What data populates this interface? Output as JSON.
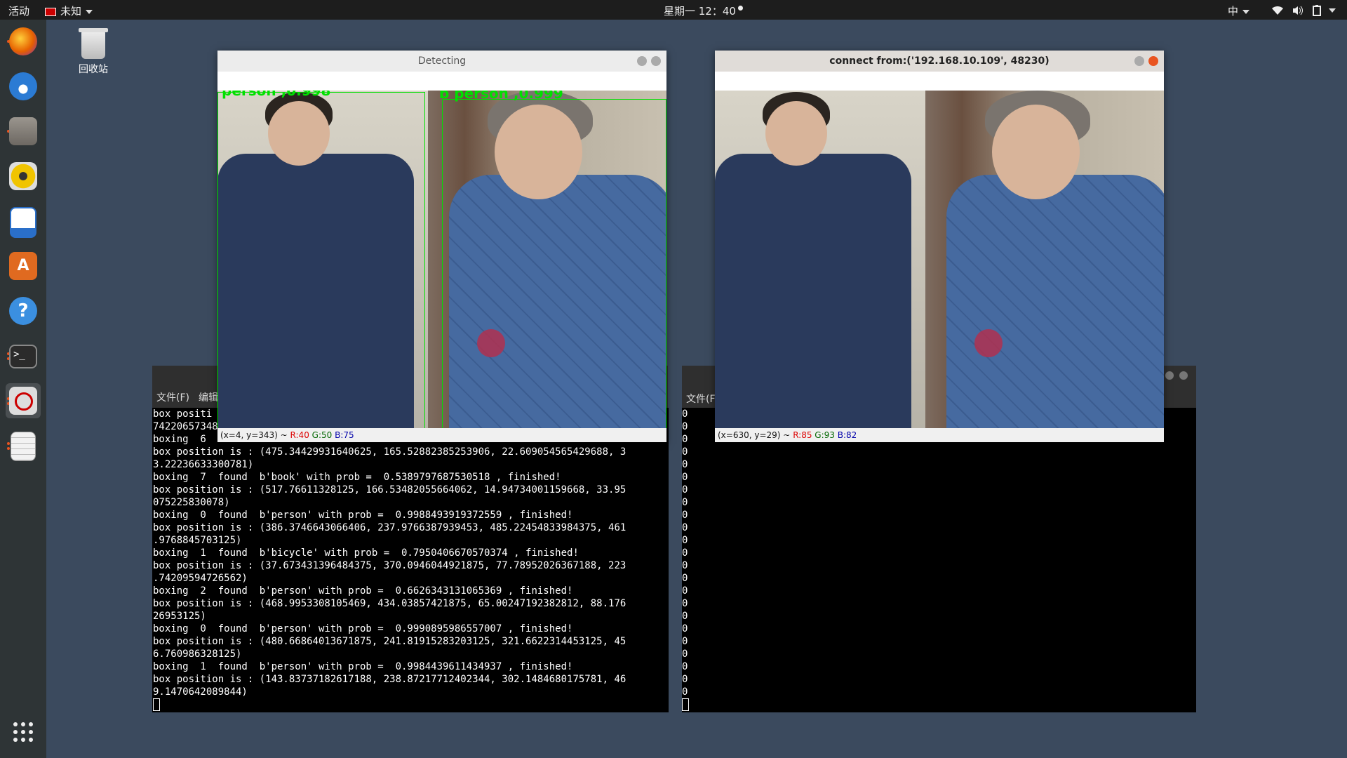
{
  "topbar": {
    "activities": "活动",
    "input_source": "未知",
    "clock": "星期一 12：40",
    "ime": "中"
  },
  "dock": {
    "apps": [
      {
        "name": "firefox-icon",
        "color": "#e66000"
      },
      {
        "name": "thunderbird-icon",
        "color": "#2b7bd4"
      },
      {
        "name": "files-icon",
        "color": "#8f8a83"
      },
      {
        "name": "rhythmbox-icon",
        "color": "#f0c400"
      },
      {
        "name": "writer-icon",
        "color": "#2a6fc9"
      },
      {
        "name": "software-icon",
        "color": "#e06a20"
      },
      {
        "name": "help-icon",
        "color": "#3b8fe0"
      },
      {
        "name": "terminal-icon",
        "color": "#2b2b2b"
      },
      {
        "name": "no-entry-icon",
        "color": "#cc0000"
      },
      {
        "name": "text-editor-icon",
        "color": "#f2f2f2"
      }
    ]
  },
  "desktop": {
    "trash_label": "回收站"
  },
  "detect_window": {
    "title": "Detecting",
    "status_coord": "(x=4, y=343) ~",
    "status_r": "R:40",
    "status_g": "G:50",
    "status_b": "B:75",
    "label_a": "person ,0.998",
    "label_b": "b person ,0.999"
  },
  "connect_window": {
    "title": "connect from:('192.168.10.109', 48230)",
    "status_coord": "(x=630, y=29) ~",
    "status_r": "R:85",
    "status_g": "G:93",
    "status_b": "B:82"
  },
  "terminal_left": {
    "menu_file": "文件(F)",
    "menu_edit": "编辑",
    "lines": [
      "box positi",
      "74220657348",
      "boxing  6",
      "box position is : (475.34429931640625, 165.52882385253906, 22.609054565429688, 3",
      "3.22236633300781)",
      "boxing  7  found  b'book' with prob =  0.5389797687530518 , finished!",
      "box position is : (517.76611328125, 166.53482055664062, 14.94734001159668, 33.95",
      "075225830078)",
      "boxing  0  found  b'person' with prob =  0.9988493919372559 , finished!",
      "box position is : (386.3746643066406, 237.9766387939453, 485.22454833984375, 461",
      ".9768845703125)",
      "boxing  1  found  b'bicycle' with prob =  0.7950406670570374 , finished!",
      "box position is : (37.673431396484375, 370.0946044921875, 77.78952026367188, 223",
      ".74209594726562)",
      "boxing  2  found  b'person' with prob =  0.6626343131065369 , finished!",
      "box position is : (468.9953308105469, 434.03857421875, 65.00247192382812, 88.176",
      "26953125)",
      "boxing  0  found  b'person' with prob =  0.9990895986557007 , finished!",
      "box position is : (480.66864013671875, 241.81915283203125, 321.6622314453125, 45",
      "6.760986328125)",
      "boxing  1  found  b'person' with prob =  0.9984439611434937 , finished!",
      "box position is : (143.83737182617188, 238.87217712402344, 302.1484680175781, 46",
      "9.1470642089844)"
    ]
  },
  "terminal_right": {
    "menu_file": "文件(F",
    "zeros": [
      "0",
      "0",
      "0",
      "0",
      "0",
      "0",
      "0",
      "0",
      "0",
      "0",
      "0",
      "0",
      "0",
      "0",
      "0",
      "0",
      "0",
      "0",
      "0",
      "0",
      "0",
      "0",
      "0"
    ]
  }
}
